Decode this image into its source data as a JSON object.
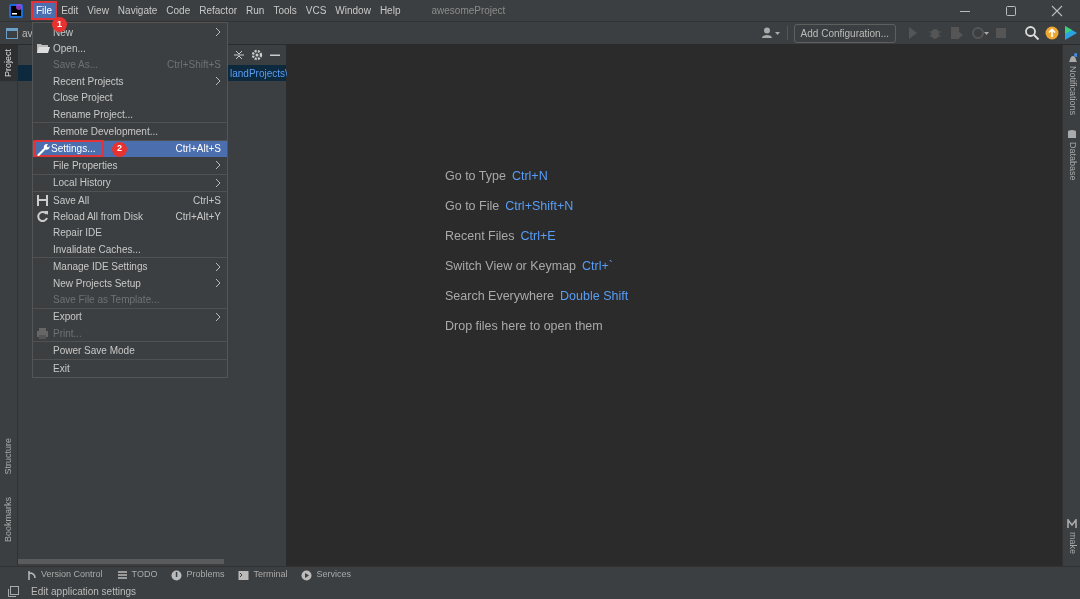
{
  "window": {
    "title": "awesomeProject"
  },
  "menu_bar": [
    {
      "label": "File",
      "selected": true,
      "highlighted": true,
      "badge": "1"
    },
    {
      "label": "Edit",
      "selected": false,
      "highlighted": false
    },
    {
      "label": "View",
      "selected": false,
      "highlighted": false
    },
    {
      "label": "Navigate",
      "selected": false,
      "highlighted": false
    },
    {
      "label": "Code",
      "selected": false,
      "highlighted": false
    },
    {
      "label": "Refactor",
      "selected": false,
      "highlighted": false
    },
    {
      "label": "Run",
      "selected": false,
      "highlighted": false
    },
    {
      "label": "Tools",
      "selected": false,
      "highlighted": false
    },
    {
      "label": "VCS",
      "selected": false,
      "highlighted": false
    },
    {
      "label": "Window",
      "selected": false,
      "highlighted": false
    },
    {
      "label": "Help",
      "selected": false,
      "highlighted": false
    }
  ],
  "nav_bar": {
    "project": "av",
    "add_configuration": "Add Configuration..."
  },
  "file_menu": {
    "groups": [
      [
        {
          "label": "New",
          "submenu": true,
          "disabled": false,
          "selected": false,
          "highlighted": false
        },
        {
          "label": "Open...",
          "submenu": false,
          "disabled": false,
          "selected": false,
          "highlighted": false
        },
        {
          "label": "Save As...",
          "shortcut": "Ctrl+Shift+S",
          "submenu": false,
          "disabled": true,
          "selected": false,
          "highlighted": false
        },
        {
          "label": "Recent Projects",
          "submenu": true,
          "disabled": false,
          "selected": false,
          "highlighted": false
        },
        {
          "label": "Close Project",
          "submenu": false,
          "disabled": false,
          "selected": false,
          "highlighted": false
        },
        {
          "label": "Rename Project...",
          "submenu": false,
          "disabled": false,
          "selected": false,
          "highlighted": false
        }
      ],
      [
        {
          "label": "Remote Development...",
          "submenu": false,
          "disabled": false,
          "selected": false,
          "highlighted": false
        }
      ],
      [
        {
          "label": "Settings...",
          "shortcut": "Ctrl+Alt+S",
          "submenu": false,
          "disabled": false,
          "selected": true,
          "highlighted": true,
          "badge": "2"
        },
        {
          "label": "File Properties",
          "submenu": true,
          "disabled": false,
          "selected": false,
          "highlighted": false
        }
      ],
      [
        {
          "label": "Local History",
          "submenu": true,
          "disabled": false,
          "selected": false,
          "highlighted": false
        }
      ],
      [
        {
          "label": "Save All",
          "shortcut": "Ctrl+S",
          "submenu": false,
          "disabled": false,
          "selected": false,
          "highlighted": false
        },
        {
          "label": "Reload All from Disk",
          "shortcut": "Ctrl+Alt+Y",
          "submenu": false,
          "disabled": false,
          "selected": false,
          "highlighted": false
        },
        {
          "label": "Repair IDE",
          "submenu": false,
          "disabled": false,
          "selected": false,
          "highlighted": false
        },
        {
          "label": "Invalidate Caches...",
          "submenu": false,
          "disabled": false,
          "selected": false,
          "highlighted": false
        }
      ],
      [
        {
          "label": "Manage IDE Settings",
          "submenu": true,
          "disabled": false,
          "selected": false,
          "highlighted": false
        },
        {
          "label": "New Projects Setup",
          "submenu": true,
          "disabled": false,
          "selected": false,
          "highlighted": false
        },
        {
          "label": "Save File as Template...",
          "submenu": false,
          "disabled": true,
          "selected": false,
          "highlighted": false
        }
      ],
      [
        {
          "label": "Export",
          "submenu": true,
          "disabled": false,
          "selected": false,
          "highlighted": false
        },
        {
          "label": "Print...",
          "submenu": false,
          "disabled": true,
          "selected": false,
          "highlighted": false
        }
      ],
      [
        {
          "label": "Power Save Mode",
          "submenu": false,
          "disabled": false,
          "selected": false,
          "highlighted": false
        }
      ],
      [
        {
          "label": "Exit",
          "submenu": false,
          "disabled": false,
          "selected": false,
          "highlighted": false
        }
      ]
    ]
  },
  "left_stripe": {
    "top": [
      {
        "label": "Project",
        "selected": true
      }
    ],
    "bottom": [
      {
        "label": "Structure",
        "selected": false
      },
      {
        "label": "Bookmarks",
        "selected": false
      }
    ]
  },
  "project_tree": {
    "rows": [
      {
        "text": "landProjects\\",
        "selected": true
      }
    ]
  },
  "editor_hints": [
    {
      "label": "Go to Type",
      "shortcut": "Ctrl+N"
    },
    {
      "label": "Go to File",
      "shortcut": "Ctrl+Shift+N"
    },
    {
      "label": "Recent Files",
      "shortcut": "Ctrl+E"
    },
    {
      "label": "Switch View or Keymap",
      "shortcut": "Ctrl+`"
    },
    {
      "label": "Search Everywhere",
      "shortcut": "Double Shift"
    },
    {
      "label": "Drop files here to open them"
    }
  ],
  "right_stripe": {
    "top": [
      "Notifications",
      "Database"
    ],
    "bottom": [
      "make"
    ]
  },
  "tool_windows": [
    "Version Control",
    "TODO",
    "Problems",
    "Terminal",
    "Services"
  ],
  "status_bar": {
    "text": "Edit application settings"
  }
}
